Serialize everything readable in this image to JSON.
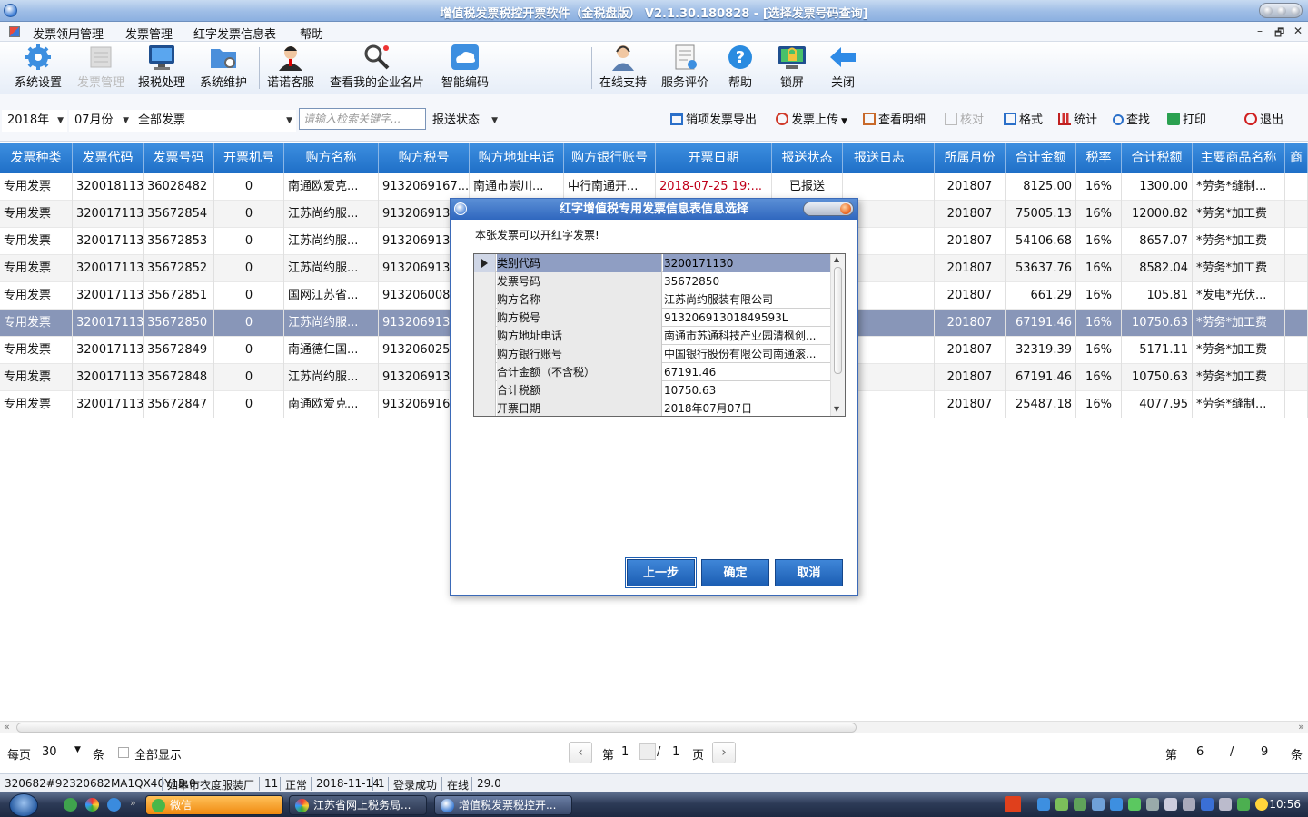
{
  "window": {
    "title": "增值税发票税控开票软件（金税盘版） V2.1.30.180828 - [选择发票号码查询]"
  },
  "menu": {
    "items": [
      "发票领用管理",
      "发票管理",
      "红字发票信息表",
      "帮助"
    ],
    "window_controls": [
      "–",
      "🗗",
      "✕"
    ]
  },
  "toolbar": {
    "items": [
      {
        "label": "系统设置",
        "icon": "gear-icon",
        "enabled": true
      },
      {
        "label": "发票管理",
        "icon": "invoice-stack-icon",
        "enabled": false
      },
      {
        "label": "报税处理",
        "icon": "monitor-icon",
        "enabled": true
      },
      {
        "label": "系统维护",
        "icon": "folder-gear-icon",
        "enabled": true
      },
      {
        "label": "诺诺客服",
        "icon": "agent-icon",
        "enabled": true
      },
      {
        "label": "查看我的企业名片",
        "icon": "magnifier-icon",
        "enabled": true
      },
      {
        "label": "智能编码",
        "icon": "cloud-icon",
        "enabled": true
      },
      {
        "label": "在线支持",
        "icon": "support-person-icon",
        "enabled": true
      },
      {
        "label": "服务评价",
        "icon": "rating-doc-icon",
        "enabled": true
      },
      {
        "label": "帮助",
        "icon": "help-icon",
        "enabled": true
      },
      {
        "label": "锁屏",
        "icon": "lock-screen-icon",
        "enabled": true
      },
      {
        "label": "关闭",
        "icon": "back-arrow-icon",
        "enabled": true
      }
    ]
  },
  "filters": {
    "year": "2018年",
    "month": "07月份",
    "invoice_type": "全部发票",
    "search_placeholder": "请输入检索关键字...",
    "report_status": "报送状态"
  },
  "actions": {
    "export": "销项发票导出",
    "upload": "发票上传",
    "view_detail": "查看明细",
    "verify": "核对",
    "format": "格式",
    "stats": "统计",
    "find": "查找",
    "print": "打印",
    "exit": "退出"
  },
  "table": {
    "headers": [
      "发票种类",
      "发票代码",
      "发票号码",
      "开票机号",
      "购方名称",
      "购方税号",
      "购方地址电话",
      "购方银行账号",
      "开票日期",
      "报送状态",
      "报送日志",
      "所属月份",
      "合计金额",
      "税率",
      "合计税额",
      "主要商品名称",
      "商"
    ],
    "rows": [
      {
        "type": "专用发票",
        "code": "3200181130",
        "number": "36028482",
        "machine": "0",
        "buyer": "南通欧爱克...",
        "tax_id": "9132069167...",
        "addr": "南通市崇川...",
        "bank": "中行南通开...",
        "date": "2018-07-25 19:...",
        "status": "已报送",
        "log": "",
        "month": "201807",
        "amount": "8125.00",
        "rate": "16%",
        "tax": "1300.00",
        "goods": "*劳务*缝制..."
      },
      {
        "type": "专用发票",
        "code": "3200171130",
        "number": "35672854",
        "machine": "0",
        "buyer": "江苏尚约服...",
        "tax_id": "9132069130...",
        "addr": "",
        "bank": "",
        "date": "",
        "status": "",
        "log": "",
        "month": "201807",
        "amount": "75005.13",
        "rate": "16%",
        "tax": "12000.82",
        "goods": "*劳务*加工费"
      },
      {
        "type": "专用发票",
        "code": "3200171130",
        "number": "35672853",
        "machine": "0",
        "buyer": "江苏尚约服...",
        "tax_id": "9132069130...",
        "addr": "",
        "bank": "",
        "date": "",
        "status": "",
        "log": "",
        "month": "201807",
        "amount": "54106.68",
        "rate": "16%",
        "tax": "8657.07",
        "goods": "*劳务*加工费"
      },
      {
        "type": "专用发票",
        "code": "3200171130",
        "number": "35672852",
        "machine": "0",
        "buyer": "江苏尚约服...",
        "tax_id": "9132069130...",
        "addr": "",
        "bank": "",
        "date": "",
        "status": "",
        "log": "",
        "month": "201807",
        "amount": "53637.76",
        "rate": "16%",
        "tax": "8582.04",
        "goods": "*劳务*加工费"
      },
      {
        "type": "专用发票",
        "code": "3200171130",
        "number": "35672851",
        "machine": "0",
        "buyer": "国网江苏省...",
        "tax_id": "9132060083...",
        "addr": "",
        "bank": "",
        "date": "",
        "status": "",
        "log": "",
        "month": "201807",
        "amount": "661.29",
        "rate": "16%",
        "tax": "105.81",
        "goods": "*发电*光伏..."
      },
      {
        "type": "专用发票",
        "code": "3200171130",
        "number": "35672850",
        "machine": "0",
        "buyer": "江苏尚约服...",
        "tax_id": "9132069130...",
        "addr": "",
        "bank": "",
        "date": "",
        "status": "",
        "log": "",
        "month": "201807",
        "amount": "67191.46",
        "rate": "16%",
        "tax": "10750.63",
        "goods": "*劳务*加工费"
      },
      {
        "type": "专用发票",
        "code": "3200171130",
        "number": "35672849",
        "machine": "0",
        "buyer": "南通德仁国...",
        "tax_id": "9132060258...",
        "addr": "",
        "bank": "",
        "date": "",
        "status": "",
        "log": "",
        "month": "201807",
        "amount": "32319.39",
        "rate": "16%",
        "tax": "5171.11",
        "goods": "*劳务*加工费"
      },
      {
        "type": "专用发票",
        "code": "3200171130",
        "number": "35672848",
        "machine": "0",
        "buyer": "江苏尚约服...",
        "tax_id": "9132069130...",
        "addr": "",
        "bank": "",
        "date": "",
        "status": "",
        "log": "",
        "month": "201807",
        "amount": "67191.46",
        "rate": "16%",
        "tax": "10750.63",
        "goods": "*劳务*加工费"
      },
      {
        "type": "专用发票",
        "code": "3200171130",
        "number": "35672847",
        "machine": "0",
        "buyer": "南通欧爱克...",
        "tax_id": "9132069167...",
        "addr": "",
        "bank": "",
        "date": "",
        "status": "",
        "log": "",
        "month": "201807",
        "amount": "25487.18",
        "rate": "16%",
        "tax": "4077.95",
        "goods": "*劳务*缝制..."
      }
    ],
    "selected_row": 5
  },
  "pager": {
    "per_page_label": "每页",
    "per_page": "30",
    "unit": "条",
    "show_all": "全部显示",
    "page_prefix": "第",
    "page": "1",
    "sep": "/",
    "total_pages": "1",
    "page_suffix": "页",
    "record_prefix": "第",
    "record": "6",
    "record_sep": "/",
    "record_total": "9",
    "record_suffix": "条"
  },
  "status": {
    "items": [
      "320682#92320682MA1QX40Y1B.0",
      "如皋市衣度服装厂",
      "11",
      "正常",
      "2018-11-14",
      "1",
      "登录成功",
      "在线",
      "29.0"
    ]
  },
  "dialog": {
    "title": "红字增值税专用发票信息表信息选择",
    "message": "本张发票可以开红字发票!",
    "rows": [
      {
        "key": "类别代码",
        "value": "3200171130"
      },
      {
        "key": "发票号码",
        "value": "35672850"
      },
      {
        "key": "购方名称",
        "value": "江苏尚约服装有限公司"
      },
      {
        "key": "购方税号",
        "value": "91320691301849593L"
      },
      {
        "key": "购方地址电话",
        "value": "南通市苏通科技产业园清枫创..."
      },
      {
        "key": "购方银行账号",
        "value": "中国银行股份有限公司南通滚..."
      },
      {
        "key": "合计金额（不含税）",
        "value": "67191.46"
      },
      {
        "key": "合计税额",
        "value": "10750.63"
      },
      {
        "key": "开票日期",
        "value": "2018年07月07日"
      }
    ],
    "buttons": {
      "prev": "上一步",
      "ok": "确定",
      "cancel": "取消"
    }
  },
  "taskbar": {
    "tasks": [
      {
        "label": "微信",
        "active": false,
        "highlight": true
      },
      {
        "label": "江苏省网上税务局...",
        "active": false,
        "highlight": false
      },
      {
        "label": "增值税发票税控开...",
        "active": true,
        "highlight": false
      }
    ],
    "clock": "10:56"
  },
  "colors": {
    "header_blue": "#2a7ad4",
    "selected_row": "#8896b8",
    "dialog_blue": "#2f67bf",
    "date_red": "#c0001a"
  }
}
